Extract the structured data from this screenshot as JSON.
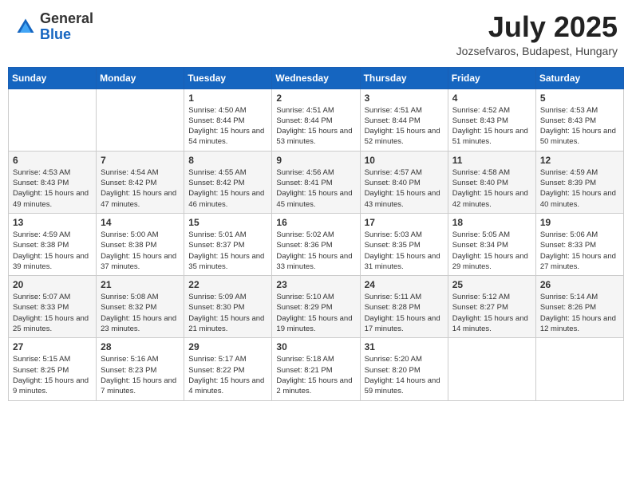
{
  "header": {
    "logo_general": "General",
    "logo_blue": "Blue",
    "month_year": "July 2025",
    "location": "Jozsefvaros, Budapest, Hungary"
  },
  "weekdays": [
    "Sunday",
    "Monday",
    "Tuesday",
    "Wednesday",
    "Thursday",
    "Friday",
    "Saturday"
  ],
  "weeks": [
    [
      {
        "day": "",
        "sunrise": "",
        "sunset": "",
        "daylight": ""
      },
      {
        "day": "",
        "sunrise": "",
        "sunset": "",
        "daylight": ""
      },
      {
        "day": "1",
        "sunrise": "Sunrise: 4:50 AM",
        "sunset": "Sunset: 8:44 PM",
        "daylight": "Daylight: 15 hours and 54 minutes."
      },
      {
        "day": "2",
        "sunrise": "Sunrise: 4:51 AM",
        "sunset": "Sunset: 8:44 PM",
        "daylight": "Daylight: 15 hours and 53 minutes."
      },
      {
        "day": "3",
        "sunrise": "Sunrise: 4:51 AM",
        "sunset": "Sunset: 8:44 PM",
        "daylight": "Daylight: 15 hours and 52 minutes."
      },
      {
        "day": "4",
        "sunrise": "Sunrise: 4:52 AM",
        "sunset": "Sunset: 8:43 PM",
        "daylight": "Daylight: 15 hours and 51 minutes."
      },
      {
        "day": "5",
        "sunrise": "Sunrise: 4:53 AM",
        "sunset": "Sunset: 8:43 PM",
        "daylight": "Daylight: 15 hours and 50 minutes."
      }
    ],
    [
      {
        "day": "6",
        "sunrise": "Sunrise: 4:53 AM",
        "sunset": "Sunset: 8:43 PM",
        "daylight": "Daylight: 15 hours and 49 minutes."
      },
      {
        "day": "7",
        "sunrise": "Sunrise: 4:54 AM",
        "sunset": "Sunset: 8:42 PM",
        "daylight": "Daylight: 15 hours and 47 minutes."
      },
      {
        "day": "8",
        "sunrise": "Sunrise: 4:55 AM",
        "sunset": "Sunset: 8:42 PM",
        "daylight": "Daylight: 15 hours and 46 minutes."
      },
      {
        "day": "9",
        "sunrise": "Sunrise: 4:56 AM",
        "sunset": "Sunset: 8:41 PM",
        "daylight": "Daylight: 15 hours and 45 minutes."
      },
      {
        "day": "10",
        "sunrise": "Sunrise: 4:57 AM",
        "sunset": "Sunset: 8:40 PM",
        "daylight": "Daylight: 15 hours and 43 minutes."
      },
      {
        "day": "11",
        "sunrise": "Sunrise: 4:58 AM",
        "sunset": "Sunset: 8:40 PM",
        "daylight": "Daylight: 15 hours and 42 minutes."
      },
      {
        "day": "12",
        "sunrise": "Sunrise: 4:59 AM",
        "sunset": "Sunset: 8:39 PM",
        "daylight": "Daylight: 15 hours and 40 minutes."
      }
    ],
    [
      {
        "day": "13",
        "sunrise": "Sunrise: 4:59 AM",
        "sunset": "Sunset: 8:38 PM",
        "daylight": "Daylight: 15 hours and 39 minutes."
      },
      {
        "day": "14",
        "sunrise": "Sunrise: 5:00 AM",
        "sunset": "Sunset: 8:38 PM",
        "daylight": "Daylight: 15 hours and 37 minutes."
      },
      {
        "day": "15",
        "sunrise": "Sunrise: 5:01 AM",
        "sunset": "Sunset: 8:37 PM",
        "daylight": "Daylight: 15 hours and 35 minutes."
      },
      {
        "day": "16",
        "sunrise": "Sunrise: 5:02 AM",
        "sunset": "Sunset: 8:36 PM",
        "daylight": "Daylight: 15 hours and 33 minutes."
      },
      {
        "day": "17",
        "sunrise": "Sunrise: 5:03 AM",
        "sunset": "Sunset: 8:35 PM",
        "daylight": "Daylight: 15 hours and 31 minutes."
      },
      {
        "day": "18",
        "sunrise": "Sunrise: 5:05 AM",
        "sunset": "Sunset: 8:34 PM",
        "daylight": "Daylight: 15 hours and 29 minutes."
      },
      {
        "day": "19",
        "sunrise": "Sunrise: 5:06 AM",
        "sunset": "Sunset: 8:33 PM",
        "daylight": "Daylight: 15 hours and 27 minutes."
      }
    ],
    [
      {
        "day": "20",
        "sunrise": "Sunrise: 5:07 AM",
        "sunset": "Sunset: 8:33 PM",
        "daylight": "Daylight: 15 hours and 25 minutes."
      },
      {
        "day": "21",
        "sunrise": "Sunrise: 5:08 AM",
        "sunset": "Sunset: 8:32 PM",
        "daylight": "Daylight: 15 hours and 23 minutes."
      },
      {
        "day": "22",
        "sunrise": "Sunrise: 5:09 AM",
        "sunset": "Sunset: 8:30 PM",
        "daylight": "Daylight: 15 hours and 21 minutes."
      },
      {
        "day": "23",
        "sunrise": "Sunrise: 5:10 AM",
        "sunset": "Sunset: 8:29 PM",
        "daylight": "Daylight: 15 hours and 19 minutes."
      },
      {
        "day": "24",
        "sunrise": "Sunrise: 5:11 AM",
        "sunset": "Sunset: 8:28 PM",
        "daylight": "Daylight: 15 hours and 17 minutes."
      },
      {
        "day": "25",
        "sunrise": "Sunrise: 5:12 AM",
        "sunset": "Sunset: 8:27 PM",
        "daylight": "Daylight: 15 hours and 14 minutes."
      },
      {
        "day": "26",
        "sunrise": "Sunrise: 5:14 AM",
        "sunset": "Sunset: 8:26 PM",
        "daylight": "Daylight: 15 hours and 12 minutes."
      }
    ],
    [
      {
        "day": "27",
        "sunrise": "Sunrise: 5:15 AM",
        "sunset": "Sunset: 8:25 PM",
        "daylight": "Daylight: 15 hours and 9 minutes."
      },
      {
        "day": "28",
        "sunrise": "Sunrise: 5:16 AM",
        "sunset": "Sunset: 8:23 PM",
        "daylight": "Daylight: 15 hours and 7 minutes."
      },
      {
        "day": "29",
        "sunrise": "Sunrise: 5:17 AM",
        "sunset": "Sunset: 8:22 PM",
        "daylight": "Daylight: 15 hours and 4 minutes."
      },
      {
        "day": "30",
        "sunrise": "Sunrise: 5:18 AM",
        "sunset": "Sunset: 8:21 PM",
        "daylight": "Daylight: 15 hours and 2 minutes."
      },
      {
        "day": "31",
        "sunrise": "Sunrise: 5:20 AM",
        "sunset": "Sunset: 8:20 PM",
        "daylight": "Daylight: 14 hours and 59 minutes."
      },
      {
        "day": "",
        "sunrise": "",
        "sunset": "",
        "daylight": ""
      },
      {
        "day": "",
        "sunrise": "",
        "sunset": "",
        "daylight": ""
      }
    ]
  ]
}
